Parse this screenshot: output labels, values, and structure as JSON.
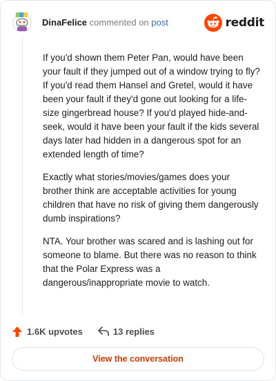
{
  "header": {
    "author": "DinaFelice",
    "action": "commented on",
    "post_link": "post",
    "brand": "reddit"
  },
  "comment": {
    "paragraphs": [
      "If you'd shown them Peter Pan, would have been your fault if they jumped out of a window trying to fly? If you'd read them Hansel and Gretel, would it have been your fault if they'd gone out looking for a life-size gingerbread house? If you'd played hide-and-seek, would it have been your fault if the kids several days later had hidden in a dangerous spot for an extended length of time?",
      "Exactly what stories/movies/games does your brother think are acceptable activities for young children that have no risk of giving them dangerously dumb inspirations?",
      "NTA. Your brother was scared and is lashing out for someone to blame. But there was no reason to think that the Polar Express was a dangerous/inappropriate movie to watch."
    ]
  },
  "actions": {
    "upvotes": "1.6K upvotes",
    "replies": "13 replies"
  },
  "view_button": "View the conversation",
  "colors": {
    "reddit_orange": "#ff4500",
    "link_blue": "#3a68b0",
    "cta_text": "#d93a00"
  },
  "icons": {
    "avatar": "snoo-avatar",
    "logo": "reddit-snoo-icon",
    "upvote": "arrow-up-icon",
    "reply": "reply-arrow-icon"
  }
}
